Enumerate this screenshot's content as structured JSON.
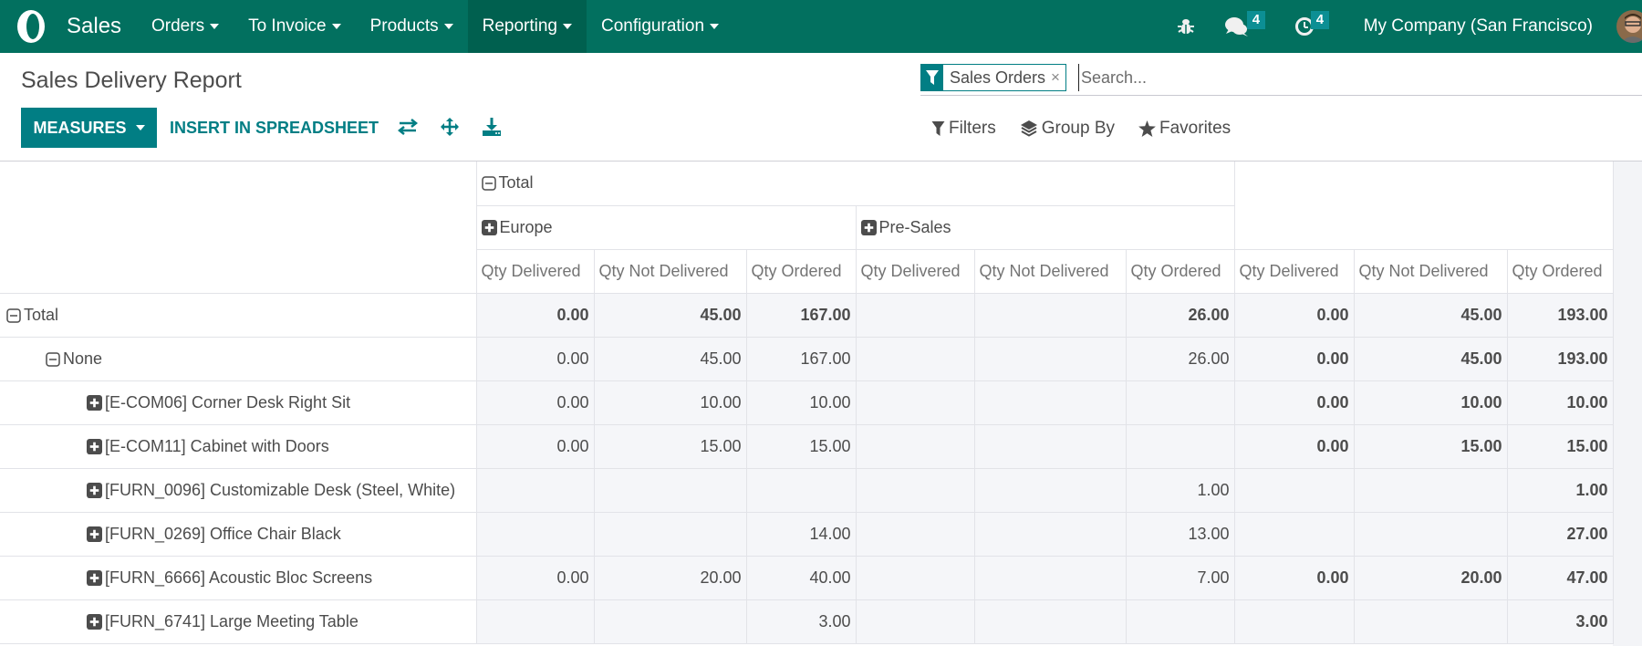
{
  "navbar": {
    "app_name": "Sales",
    "menu": [
      {
        "label": "Orders",
        "active": false
      },
      {
        "label": "To Invoice",
        "active": false
      },
      {
        "label": "Products",
        "active": false
      },
      {
        "label": "Reporting",
        "active": true
      },
      {
        "label": "Configuration",
        "active": false
      }
    ],
    "messages_badge": "4",
    "activities_badge": "4",
    "company": "My Company (San Francisco)",
    "colors": {
      "navbar": "#02705f",
      "active_item": "#00604f",
      "badge": "#0c8f94"
    }
  },
  "control_panel": {
    "title": "Sales Delivery Report",
    "measures_label": "MEASURES",
    "insert_label": "INSERT IN SPREADSHEET",
    "tool_icons": [
      "flip-axis-icon",
      "expand-all-icon",
      "download-icon"
    ],
    "search": {
      "facet_label": "Sales Orders",
      "facet_remove": "×",
      "placeholder": "Search...",
      "value": ""
    },
    "filters_label": "Filters",
    "group_by_label": "Group By",
    "favorites_label": "Favorites",
    "accent_color": "#017e84"
  },
  "pivot": {
    "col_total_label": "Total",
    "col_groups": [
      {
        "label": "Europe",
        "expanded": false
      },
      {
        "label": "Pre-Sales",
        "expanded": false
      }
    ],
    "measures": [
      "Qty Delivered",
      "Qty Not Delivered",
      "Qty Ordered"
    ],
    "rows": [
      {
        "label": "Total",
        "level": 0,
        "toggle": "collapse",
        "bold": true,
        "values": [
          "0.00",
          "45.00",
          "167.00",
          "",
          "",
          "26.00",
          "0.00",
          "45.00",
          "193.00"
        ]
      },
      {
        "label": "None",
        "level": 1,
        "toggle": "collapse",
        "bold": false,
        "values": [
          "0.00",
          "45.00",
          "167.00",
          "",
          "",
          "26.00",
          "0.00",
          "45.00",
          "193.00"
        ]
      },
      {
        "label": "[E-COM06] Corner Desk Right Sit",
        "level": 2,
        "toggle": "expand",
        "bold": false,
        "values": [
          "0.00",
          "10.00",
          "10.00",
          "",
          "",
          "",
          "0.00",
          "10.00",
          "10.00"
        ]
      },
      {
        "label": "[E-COM11] Cabinet with Doors",
        "level": 2,
        "toggle": "expand",
        "bold": false,
        "values": [
          "0.00",
          "15.00",
          "15.00",
          "",
          "",
          "",
          "0.00",
          "15.00",
          "15.00"
        ]
      },
      {
        "label": "[FURN_0096] Customizable Desk (Steel, White)",
        "level": 2,
        "toggle": "expand",
        "bold": false,
        "values": [
          "",
          "",
          "",
          "",
          "",
          "1.00",
          "",
          "",
          "1.00"
        ]
      },
      {
        "label": "[FURN_0269] Office Chair Black",
        "level": 2,
        "toggle": "expand",
        "bold": false,
        "values": [
          "",
          "",
          "14.00",
          "",
          "",
          "13.00",
          "",
          "",
          "27.00"
        ]
      },
      {
        "label": "[FURN_6666] Acoustic Bloc Screens",
        "level": 2,
        "toggle": "expand",
        "bold": false,
        "values": [
          "0.00",
          "20.00",
          "40.00",
          "",
          "",
          "7.00",
          "0.00",
          "20.00",
          "47.00"
        ]
      },
      {
        "label": "[FURN_6741] Large Meeting Table",
        "level": 2,
        "toggle": "expand",
        "bold": false,
        "values": [
          "",
          "",
          "3.00",
          "",
          "",
          "",
          "",
          "",
          "3.00"
        ]
      }
    ]
  }
}
